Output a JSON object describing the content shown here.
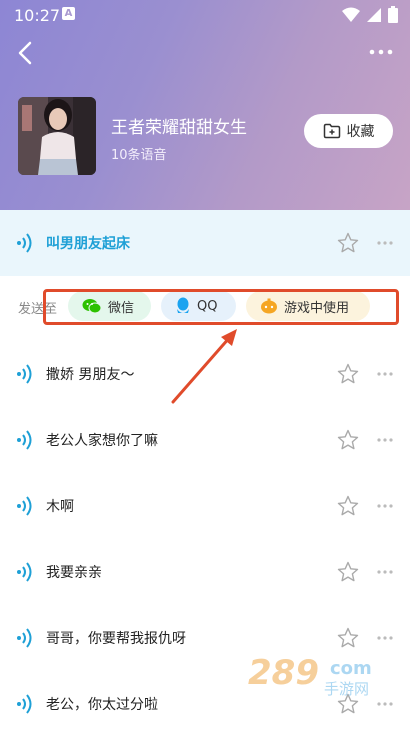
{
  "status_bar": {
    "time": "10:27",
    "notif_letter": "A"
  },
  "header": {
    "title": "王者荣耀甜甜女生",
    "count": "10条语音",
    "favorite_label": "收藏"
  },
  "send_to": {
    "label": "发送至",
    "options": [
      {
        "label": "微信",
        "icon": "wechat-icon",
        "color": "#2dc100"
      },
      {
        "label": "QQ",
        "icon": "qq-icon",
        "color": "#1aa3f0"
      },
      {
        "label": "游戏中使用",
        "icon": "game-icon",
        "color": "#f5a623"
      }
    ]
  },
  "voices": [
    {
      "name": "叫男朋友起床",
      "active": true
    },
    {
      "name": "撒娇 男朋友～"
    },
    {
      "name": "老公人家想你了嘛"
    },
    {
      "name": "木啊"
    },
    {
      "name": "我要亲亲"
    },
    {
      "name": "哥哥，你要帮我报仇呀"
    },
    {
      "name": "老公，你太过分啦"
    }
  ],
  "colors": {
    "accent": "#1ea0d6",
    "annotation": "#e04b2b",
    "header_from": "#8d86d4",
    "header_to": "#c7a4c6"
  },
  "watermark": {
    "digits": "289",
    "suffix": "com",
    "sub": "手游网"
  }
}
